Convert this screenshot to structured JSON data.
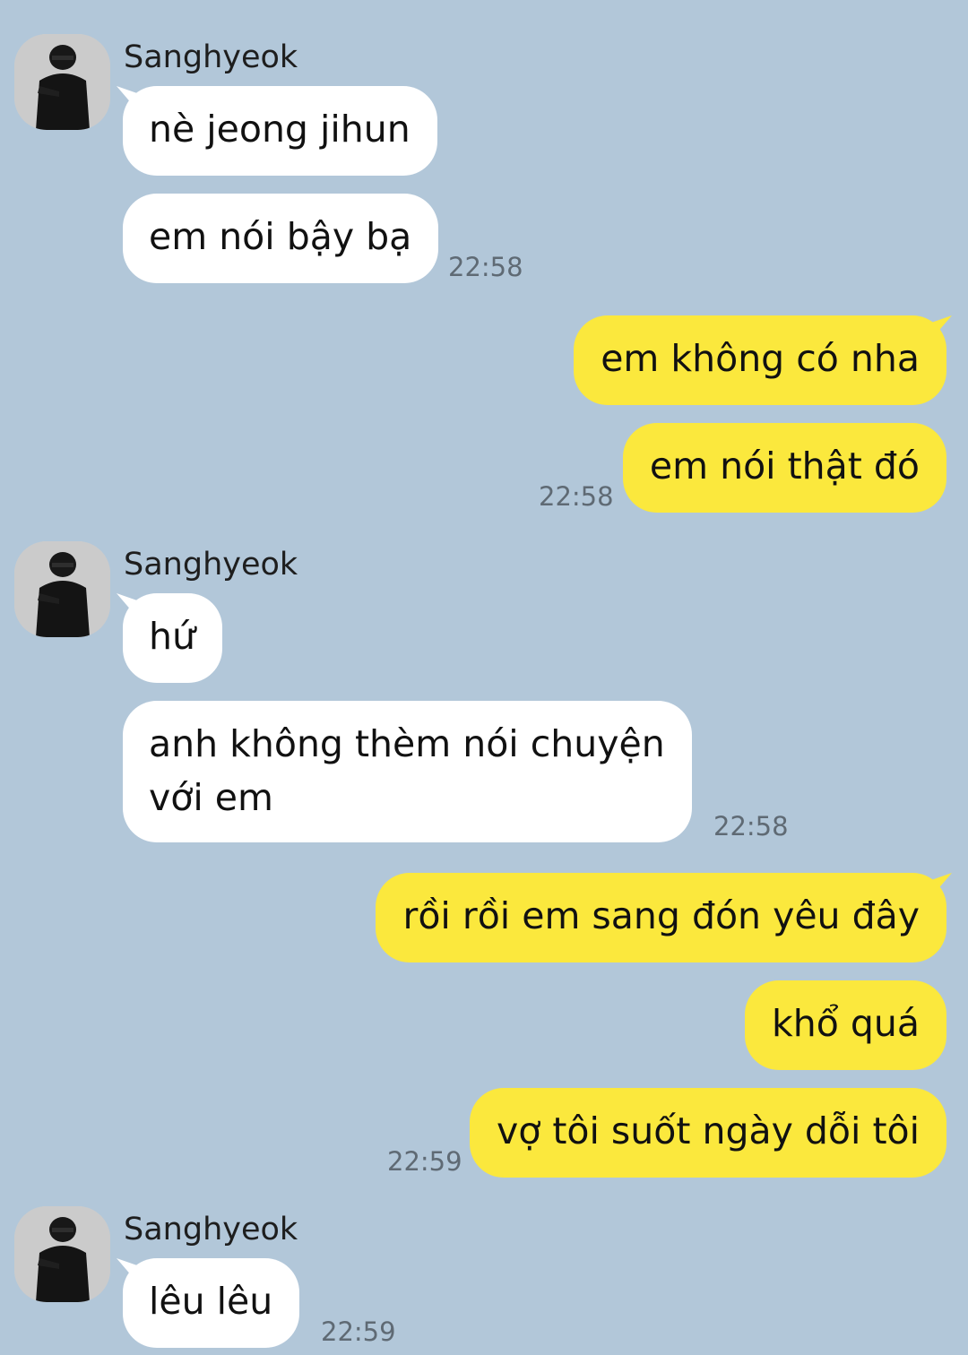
{
  "chat": {
    "groups": [
      {
        "sender": "Sanghyeok",
        "messages": [
          "nè jeong jihun",
          "em nói bậy bạ"
        ],
        "time": "22:58"
      },
      {
        "messages": [
          "em không có nha",
          "em nói thật đó"
        ],
        "time": "22:58"
      },
      {
        "sender": "Sanghyeok",
        "messages": [
          "hứ",
          "anh không thèm nói chuyện",
          "với em"
        ],
        "time": "22:58"
      },
      {
        "messages": [
          "rồi rồi em sang đón yêu đây",
          "khổ quá",
          "vợ tôi suốt ngày dỗi tôi"
        ],
        "time": "22:59"
      },
      {
        "sender": "Sanghyeok",
        "messages": [
          "lêu lêu"
        ],
        "time": "22:59"
      }
    ]
  },
  "colors": {
    "background": "#b2c7d9",
    "incoming_bubble": "#ffffff",
    "outgoing_bubble": "#fbe83d"
  }
}
